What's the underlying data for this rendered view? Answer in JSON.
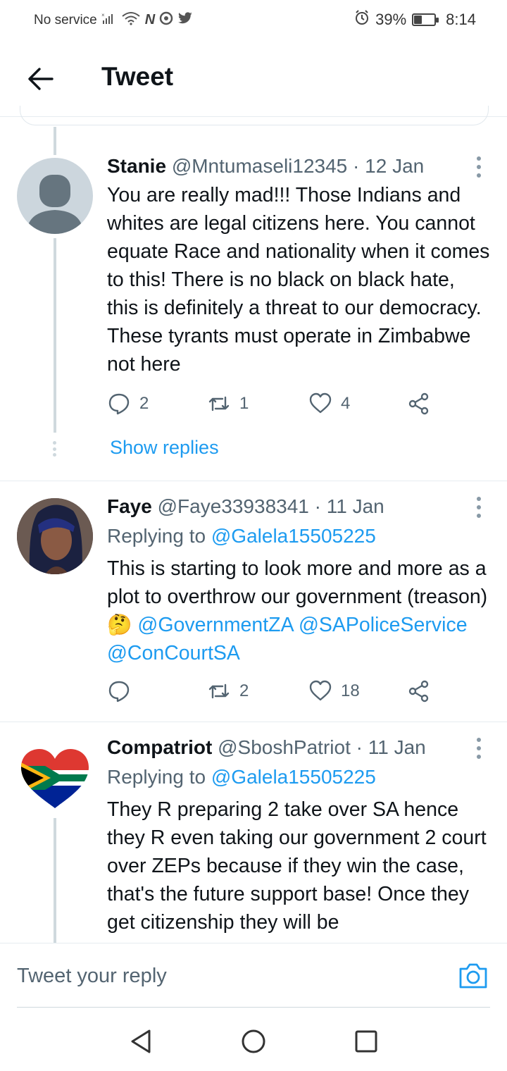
{
  "status_bar": {
    "carrier": "No service",
    "battery": "39%",
    "battery_level": 0.39,
    "time": "8:14"
  },
  "header": {
    "title": "Tweet"
  },
  "tweets": [
    {
      "name": "Stanie",
      "handle": "@Mntumaseli12345",
      "date": "· 12 Jan",
      "text": "You are really mad!!! Those Indians and whites are legal citizens here. You cannot equate Race and nationality when it comes to this! There is no black on black hate, this is definitely a threat to our democracy. These tyrants must operate in Zimbabwe not here",
      "replies": "2",
      "retweets": "1",
      "likes": "4",
      "show_replies": "Show replies"
    },
    {
      "name": "Faye",
      "handle": "@Faye33938341",
      "date": "· 11 Jan",
      "replying_prefix": "Replying to",
      "replying_to": "@Galela15505225",
      "text": "This is starting to look more and more as a plot to overthrow our government (treason)",
      "emoji": "🤔",
      "mentions": [
        "@GovernmentZA",
        "@SAPoliceService",
        "@ConCourtSA"
      ],
      "replies": "",
      "retweets": "2",
      "likes": "18"
    },
    {
      "name": "Compatriot",
      "handle": "@SboshPatriot",
      "date": "· 11 Jan",
      "replying_prefix": "Replying to",
      "replying_to": "@Galela15505225",
      "text": "They R preparing 2 take over SA hence they R even taking our government 2 court over ZEPs because if they win the case, that's the future support base! Once they get citizenship they will be"
    }
  ],
  "reply_bar": {
    "placeholder": "Tweet your reply"
  },
  "icons": {
    "back": "arrow-left-icon",
    "reply": "speech-bubble-icon",
    "retweet": "retweet-icon",
    "like": "heart-icon",
    "share": "share-icon",
    "camera": "camera-icon"
  }
}
